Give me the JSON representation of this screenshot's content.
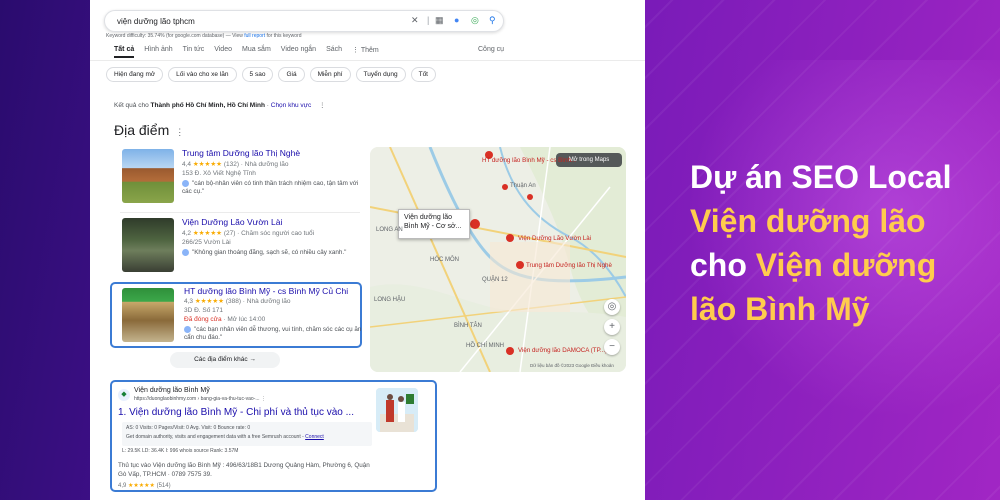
{
  "search": {
    "query": "viện dưỡng lão tphcm",
    "keyword_difficulty_label": "Keyword difficulty:",
    "keyword_difficulty_value": "35.74%",
    "keyword_difficulty_source": "(for google.com database) — View",
    "keyword_difficulty_link": "full report",
    "keyword_difficulty_tail": "for this keyword"
  },
  "tabs": [
    "Tất cả",
    "Hình ảnh",
    "Tin tức",
    "Video",
    "Mua sắm",
    "Video ngắn",
    "Sách",
    "⋮ Thêm"
  ],
  "tools_label": "Công cụ",
  "chips": [
    "Hiện đang mở",
    "Lối vào cho xe lăn",
    "5 sao",
    "Giá",
    "Miễn phí",
    "Tuyển dụng",
    "Tốt"
  ],
  "location": {
    "prefix": "Kết quả cho",
    "place": "Thành phố Hồ Chí Minh, Hồ Chí Minh",
    "sep": " · ",
    "link": "Chọn khu vực"
  },
  "places_title": "Địa điểm",
  "places": [
    {
      "name": "Trung tâm Dưỡng lão Thị Nghè",
      "rating": "4,4",
      "stars": "★★★★★",
      "meta": "(132) · Nhà dưỡng lão",
      "address": "153 Đ. Xô Viết Nghệ Tĩnh",
      "review": "\"cán bộ-nhân viên có tinh thần trách nhiệm cao, tận tâm với các cụ.\""
    },
    {
      "name": "Viện Dưỡng Lão Vườn Lài",
      "rating": "4,2",
      "stars": "★★★★★",
      "meta": "(27) · Chăm sóc người cao tuổi",
      "address": "266/25 Vườn Lài",
      "review": "\"Không gian thoáng đãng, sạch sẽ, có nhiều cây xanh.\""
    },
    {
      "name": "HT dưỡng lão Bình Mỹ - cs Bình Mỹ Củ Chi",
      "rating": "4,3",
      "stars": "★★★★★",
      "meta": "(388) · Nhà dưỡng lão",
      "address": "3D Đ. Số 171",
      "status_closed": "Đã đóng cửa",
      "status_open": " · Mở lúc 14:00",
      "review": "\"các bạn nhân viên dễ thương, vui tính, chăm sóc các cụ ăn cẩn chu đáo.\""
    }
  ],
  "more_places": "Các địa điểm khác  →",
  "map": {
    "open_maps": "Mở trong Maps",
    "callout": "Viện dưỡng lão Bình Mỹ - Cơ sở...",
    "pin_labels": [
      "HT dưỡng lão Bình Mỹ - cs Bình...",
      "Viện Dưỡng Lão Vườn Lài",
      "Trung tâm Dưỡng lão Thị Nghè",
      "Viện dưỡng lão DAMOCA (TP...)"
    ],
    "area_labels": [
      "Thuận An",
      "LONG AN",
      "HÓC MÔN",
      "QUẬN 12",
      "LONG HẬU",
      "BÌNH TÂN",
      "HỒ CHÍ MINH"
    ],
    "attribution": "Dữ liệu bản đồ ©2023 Google   Điều khoản"
  },
  "organic": {
    "site": "Viện dưỡng lão Bình Mỹ",
    "url": "https://duonglaobinhmy.com › bang-gia-va-thu-tuc-vao-...  ⋮",
    "title": "1. Viện dưỡng lão Bình Mỹ - Chi phí và thủ tục vào ...",
    "seo_row1": "AS: 0    Visits: 0    Pages/Visit: 0    Avg. Visit: 0    Bounce rate: 0",
    "seo_row2_text": "Get domain authority, visits and engagement data with a free Semrush account -",
    "seo_row2_link": "Connect",
    "seo_row3": "L: 29.5K    LD: 36.4K    I: 996    whois    source    Rank: 3.57M",
    "desc": "Thủ tục vào Viện dưỡng lão Bình Mỹ : 496/63/18B1 Dương Quảng Hàm, Phường 6, Quận Gò Vấp, TP.HCM · 0789 7575 39.",
    "rating": "4,9",
    "stars": "★★★★★",
    "count": "(514)"
  },
  "headline": {
    "line1": "Dự án SEO Local",
    "line2": "Viện dưỡng lão",
    "line3a": "cho ",
    "line3b": "Viện dưỡng",
    "line4": "lão Bình Mỹ"
  },
  "colors": {
    "link_blue": "#1a0dab",
    "highlight_border": "#3b7bd4",
    "star": "#f9ab00",
    "headline_yellow": "#ffcc4d",
    "bg_purple": "#7a1bb8"
  }
}
